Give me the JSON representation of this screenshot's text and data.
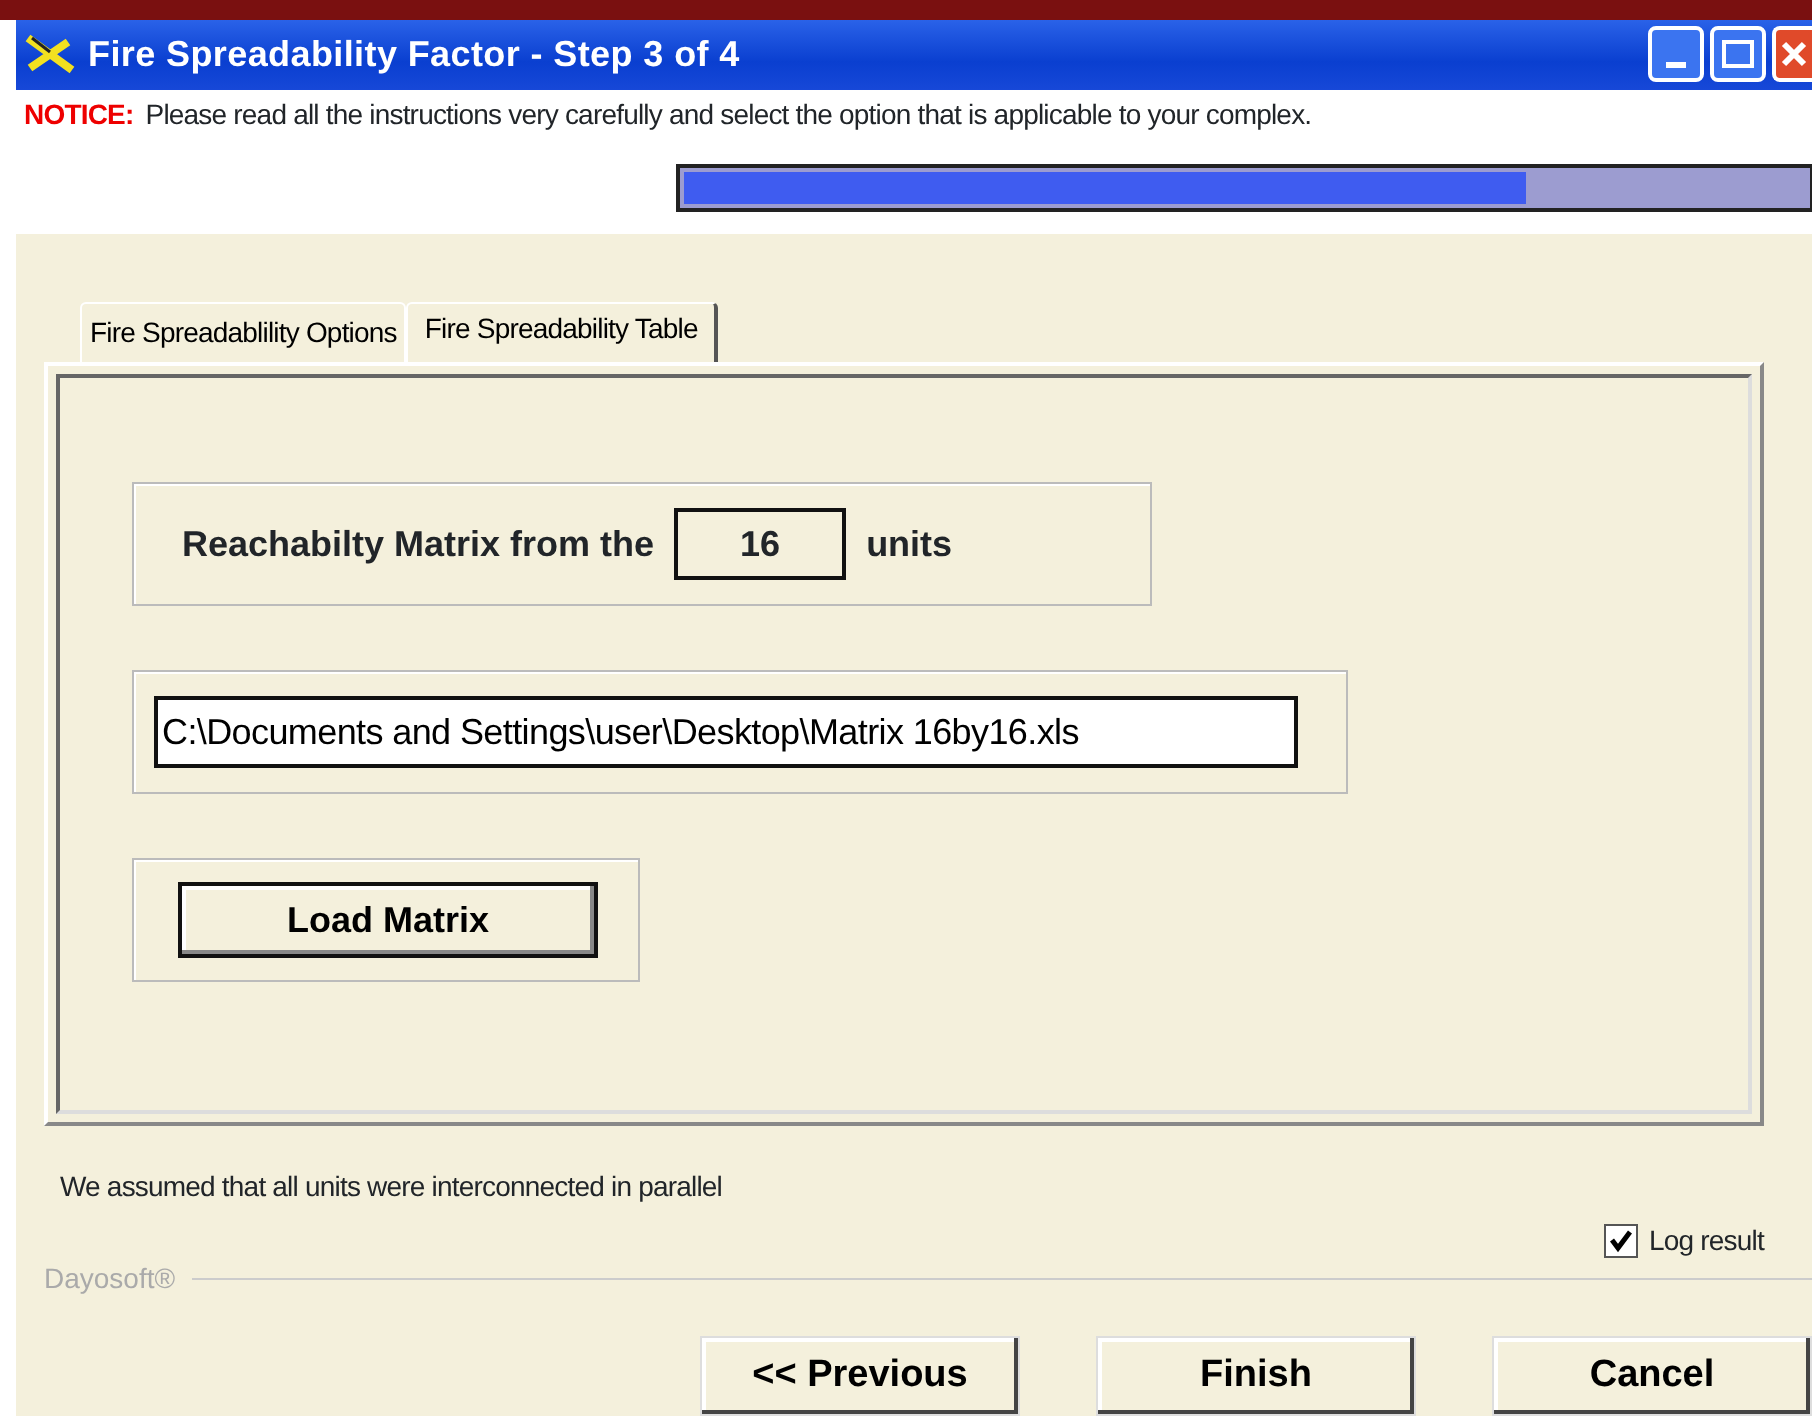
{
  "window": {
    "title": "Fire Spreadability Factor - Step 3 of 4"
  },
  "notice": {
    "label": "NOTICE:",
    "text": "Please read all the instructions very carefully and select the option that is applicable to your complex."
  },
  "progress": {
    "level": 0.75
  },
  "tabs": [
    {
      "label": "Fire Spreadablility Options",
      "selected": false
    },
    {
      "label": "Fire Spreadability Table",
      "selected": true
    }
  ],
  "matrix": {
    "label": "Reachabilty Matrix from the",
    "value": "16",
    "suffix": "units"
  },
  "file_path": {
    "value": "C:\\Documents and Settings\\user\\Desktop\\Matrix 16by16.xls"
  },
  "load_button": "Load Matrix",
  "assumption": "We assumed that all units were interconnected in parallel",
  "log_result": {
    "label": "Log result",
    "checked": true
  },
  "brand": "Dayosoft®",
  "buttons": [
    "<< Previous",
    "Finish",
    "Cancel"
  ]
}
